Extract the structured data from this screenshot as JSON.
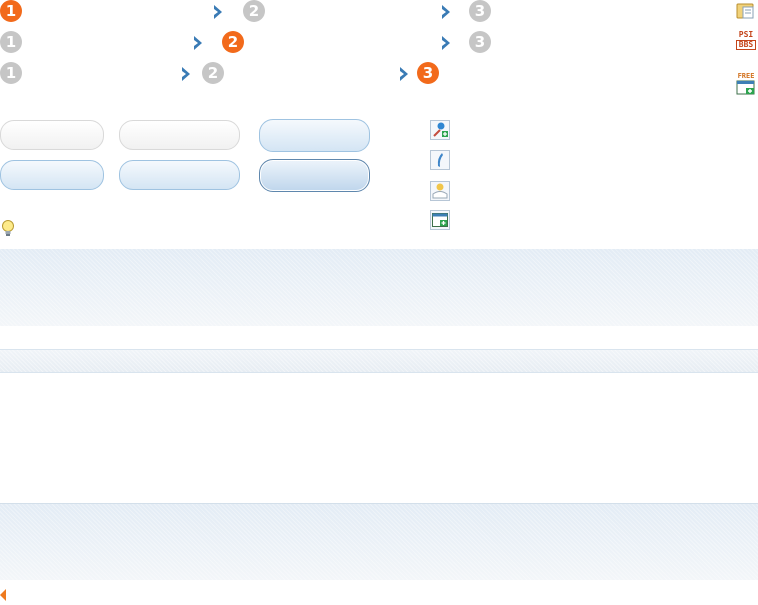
{
  "step_rows": [
    {
      "steps": [
        "1",
        "2",
        "3"
      ],
      "active": 0
    },
    {
      "steps": [
        "1",
        "2",
        "3"
      ],
      "active": 1
    },
    {
      "steps": [
        "1",
        "2",
        "3"
      ],
      "active": 2
    }
  ],
  "right_icons": [
    "folder-note-icon",
    "psi-bbs-icon",
    "free-window-icon"
  ],
  "psi_label_top": "PSI",
  "psi_label_bottom": "BBS",
  "free_label": "FREE",
  "action_icons": [
    "user-add-icon",
    "phone-icon",
    "user-chat-icon",
    "window-add-icon"
  ],
  "buttons": [
    {
      "style": "grey"
    },
    {
      "style": "grey"
    },
    {
      "style": "blue"
    },
    {
      "style": "blue"
    },
    {
      "style": "blue"
    },
    {
      "style": "blue-dark"
    }
  ],
  "hint_icon": "lightbulb-icon",
  "pager_icon": "triangle-left-icon",
  "colors": {
    "active_step": "#f26a1b",
    "inactive_step": "#c6c6c6",
    "arrow": "#3a7bb5",
    "panel": "#e3ecf5"
  }
}
